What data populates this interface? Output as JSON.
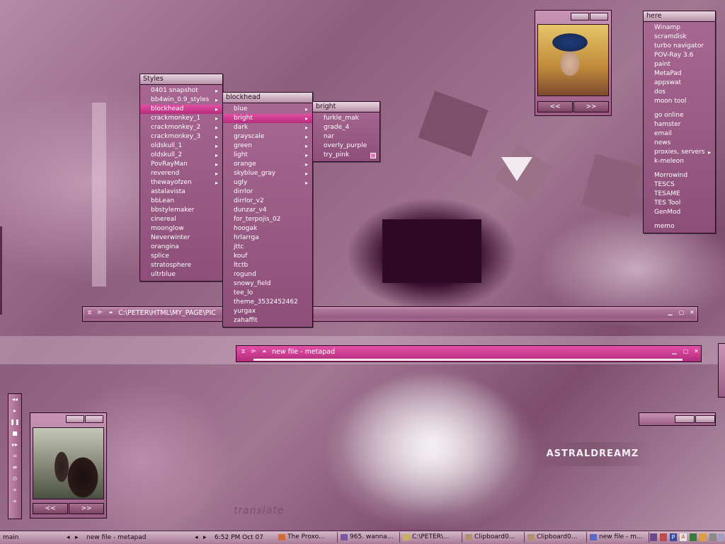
{
  "styles_menu": {
    "title": "Styles",
    "items": [
      {
        "label": "0401 snapshot",
        "sub": true
      },
      {
        "label": "bb4win_0.9_styles",
        "sub": true
      },
      {
        "label": "blockhead",
        "sub": true,
        "selected": true
      },
      {
        "label": "crackmonkey_1",
        "sub": true
      },
      {
        "label": "crackmonkey_2",
        "sub": true
      },
      {
        "label": "crackmonkey_3",
        "sub": true
      },
      {
        "label": "oldskull_1",
        "sub": true
      },
      {
        "label": "oldskull_2",
        "sub": true
      },
      {
        "label": "PovRayMan",
        "sub": true
      },
      {
        "label": "reverend",
        "sub": true
      },
      {
        "label": "thewayofzen",
        "sub": true
      },
      {
        "label": "astalavista"
      },
      {
        "label": "bbLean"
      },
      {
        "label": "bbstylemaker"
      },
      {
        "label": "cinereal"
      },
      {
        "label": "moonglow"
      },
      {
        "label": "Neverwinter"
      },
      {
        "label": "orangina"
      },
      {
        "label": "splice"
      },
      {
        "label": "stratosphere"
      },
      {
        "label": "ultrblue"
      }
    ]
  },
  "blockhead_menu": {
    "title": "blockhead",
    "items": [
      {
        "label": "blue",
        "sub": true
      },
      {
        "label": "bright",
        "sub": true,
        "selected": true
      },
      {
        "label": "dark",
        "sub": true
      },
      {
        "label": "grayscale",
        "sub": true
      },
      {
        "label": "green",
        "sub": true
      },
      {
        "label": "light",
        "sub": true
      },
      {
        "label": "orange",
        "sub": true
      },
      {
        "label": "skyblue_gray",
        "sub": true
      },
      {
        "label": "ugly",
        "sub": true
      },
      {
        "label": "dirrlor"
      },
      {
        "label": "dirrlor_v2"
      },
      {
        "label": "dunzar_v4"
      },
      {
        "label": "for_terpojis_02"
      },
      {
        "label": "hoogak"
      },
      {
        "label": "hrlarrga"
      },
      {
        "label": "jttc"
      },
      {
        "label": "kouf"
      },
      {
        "label": "ltctb"
      },
      {
        "label": "rogund"
      },
      {
        "label": "snowy_field"
      },
      {
        "label": "tee_lo"
      },
      {
        "label": "theme_3532452462"
      },
      {
        "label": "yurgax"
      },
      {
        "label": "zahaffit"
      }
    ]
  },
  "bright_menu": {
    "title": "bright",
    "items": [
      {
        "label": "furkle_mak"
      },
      {
        "label": "grade_4"
      },
      {
        "label": "nar"
      },
      {
        "label": "overly_purple"
      },
      {
        "label": "try_pink",
        "checked": true
      }
    ]
  },
  "here_menu": {
    "title": "here",
    "items": [
      {
        "label": "Winamp"
      },
      {
        "label": "scramdisk"
      },
      {
        "label": "turbo navigator"
      },
      {
        "label": "POV-Ray 3.6"
      },
      {
        "label": "paint"
      },
      {
        "label": "MetaPad"
      },
      {
        "label": "appswat"
      },
      {
        "label": "dos"
      },
      {
        "label": "moon tool"
      },
      {
        "label": "go online",
        "gap": true
      },
      {
        "label": "hamster"
      },
      {
        "label": "email"
      },
      {
        "label": "news"
      },
      {
        "label": "proxies, servers",
        "sub": true
      },
      {
        "label": "k-meleon"
      },
      {
        "label": "Morrowind",
        "gap": true
      },
      {
        "label": "TESCS"
      },
      {
        "label": "TESAME"
      },
      {
        "label": "TES Tool"
      },
      {
        "label": "GenMod"
      },
      {
        "label": "memo",
        "gap": true
      }
    ]
  },
  "explorer_window": {
    "title": "C:\\PETER\\HTML\\MY_PAGE\\PIC"
  },
  "metapad_window": {
    "title": "new file - metapad"
  },
  "picture_widget": {
    "prev": "<<",
    "next": ">>"
  },
  "wallpaper_text": {
    "brand": "ASTRALDREAMZ",
    "sign": "translate"
  },
  "taskbar": {
    "workspace": "main",
    "current_window": "new file - metapad",
    "clock": "6:52 PM Oct 07",
    "tasks": [
      {
        "label": "The Proxo..."
      },
      {
        "label": "965. wanna..."
      },
      {
        "label": "C:\\PETER\\..."
      },
      {
        "label": "Clipboard0..."
      },
      {
        "label": "Clipboard0..."
      },
      {
        "label": "new file - m..."
      }
    ]
  },
  "colors": {
    "accent": "#e24fa6",
    "frame": "#2a0a20",
    "menu_bg": "#9c5d86"
  }
}
